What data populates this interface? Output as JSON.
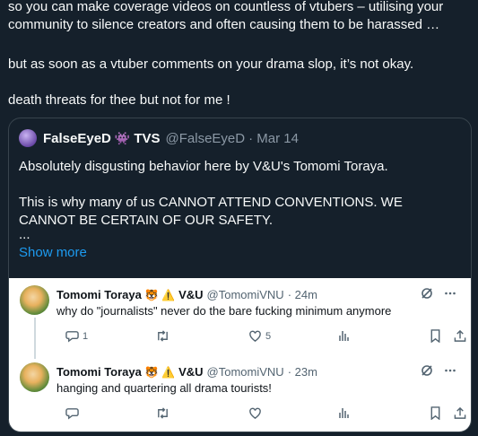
{
  "post": {
    "line1": "so you can make coverage videos on countless of vtubers – utilising your community to silence creators and often causing them to be harassed …",
    "line2": "but as soon as a vtuber comments on your drama slop, it’s not okay.",
    "line3": "death threats for thee but not for me !"
  },
  "quote": {
    "name": "FalseEyeD",
    "emoji": "👾",
    "suffix": "TVS",
    "handle": "@FalseEyeD",
    "date": "· Mar 14",
    "text1": "Absolutely disgusting behavior here by V&U's Tomomi Toraya.",
    "text2": "This is why many of us CANNOT ATTEND CONVENTIONS. WE CANNOT BE CERTAIN OF OUR SAFETY.",
    "ellipsis": "...",
    "show_more": "Show more"
  },
  "embed": {
    "tweets": [
      {
        "name": "Tomomi Toraya",
        "badges": "🐯 ⚠️",
        "org": "V&U",
        "handle": "@TomomiVNU",
        "time": "· 24m",
        "text": "why do \"journalists\" never do the bare fucking minimum anymore",
        "replies": "1",
        "retweets": "",
        "likes": "5"
      },
      {
        "name": "Tomomi Toraya",
        "badges": "🐯 ⚠️",
        "org": "V&U",
        "handle": "@TomomiVNU",
        "time": "· 23m",
        "text": "hanging and quartering all drama tourists!",
        "replies": "",
        "retweets": "",
        "likes": ""
      }
    ]
  },
  "colors": {
    "background": "#15202b",
    "link": "#1d9bf0",
    "embed_bg": "#ffffff",
    "muted": "#536471"
  },
  "icons": [
    "reply-icon",
    "retweet-icon",
    "like-icon",
    "views-icon",
    "bookmark-icon",
    "share-icon",
    "grok-icon",
    "more-icon"
  ]
}
